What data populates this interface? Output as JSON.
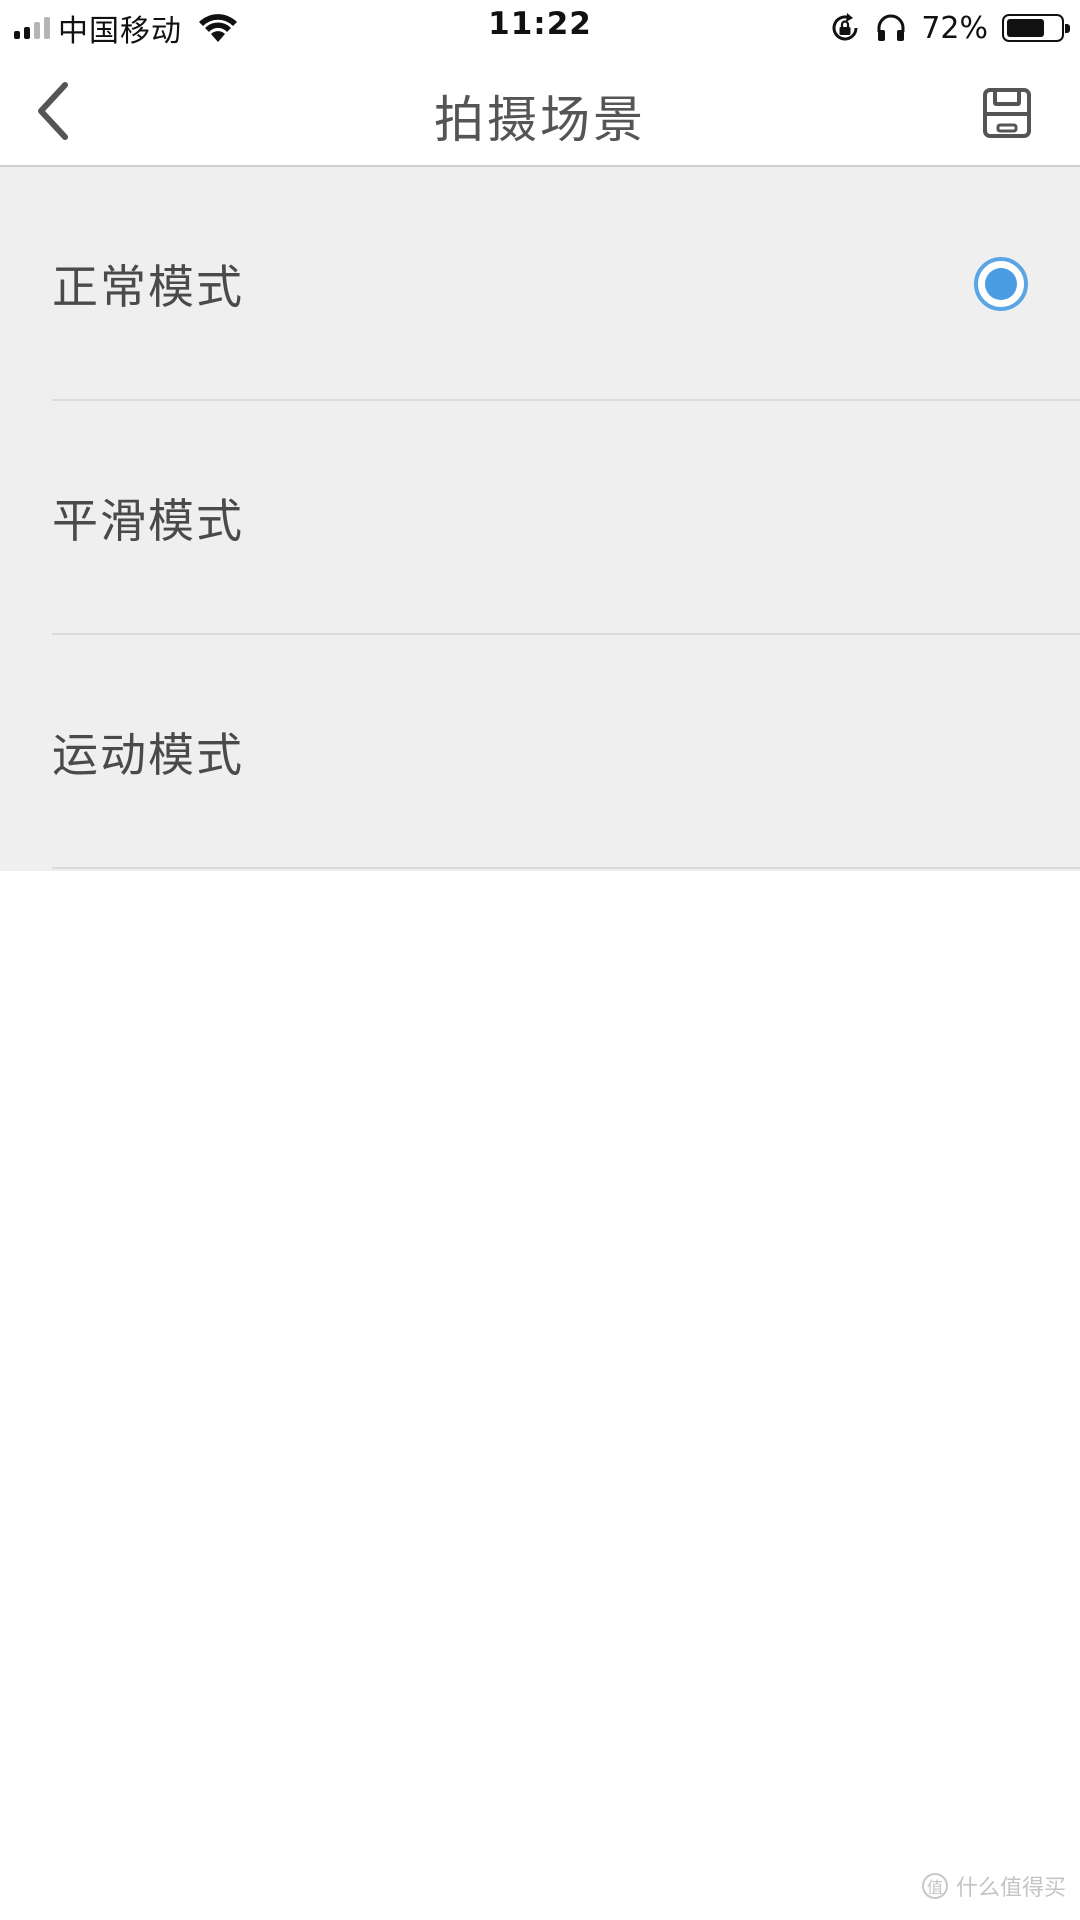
{
  "status_bar": {
    "carrier": "中国移动",
    "time": "11:22",
    "battery_percent_text": "72%",
    "battery_level": 0.72,
    "signal_bars_active": 2,
    "signal_bars_total": 4,
    "icons": [
      "signal-icon",
      "wifi-icon",
      "rotation-lock-icon",
      "headphones-icon",
      "battery-icon"
    ]
  },
  "nav": {
    "title": "拍摄场景",
    "back_icon": "chevron-left-icon",
    "save_icon": "floppy-disk-icon"
  },
  "modes": [
    {
      "label": "正常模式",
      "selected": true
    },
    {
      "label": "平滑模式",
      "selected": false
    },
    {
      "label": "运动模式",
      "selected": false
    }
  ],
  "colors": {
    "accent": "#4a9de3",
    "list_background": "#efefef",
    "page_background": "#ffffff"
  },
  "watermark": {
    "text": "什么值得买",
    "badge": "值"
  }
}
